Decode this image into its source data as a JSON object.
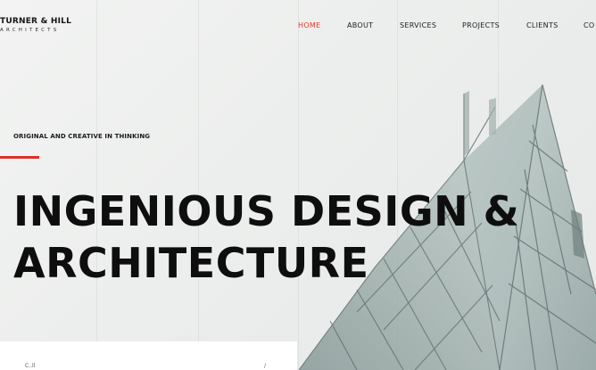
{
  "brand": {
    "name": "TURNER & HILL",
    "tagline": "ARCHITECTS"
  },
  "nav": {
    "items": [
      {
        "label": "HOME",
        "active": true
      },
      {
        "label": "ABOUT",
        "active": false
      },
      {
        "label": "SERVICES",
        "active": false
      },
      {
        "label": "PROJECTS",
        "active": false
      },
      {
        "label": "CLIENTS",
        "active": false
      },
      {
        "label": "CO",
        "active": false
      }
    ]
  },
  "hero": {
    "subtitle": "ORIGINAL AND CREATIVE IN THINKING",
    "title_line1": "INGENIOUS DESIGN &",
    "title_line2": "ARCHITECTURE"
  },
  "panel": {
    "text": "C..ll",
    "mark": "/"
  },
  "colors": {
    "accent": "#dd3128",
    "nav_active": "#e23a2e",
    "text": "#0e0e0e"
  }
}
